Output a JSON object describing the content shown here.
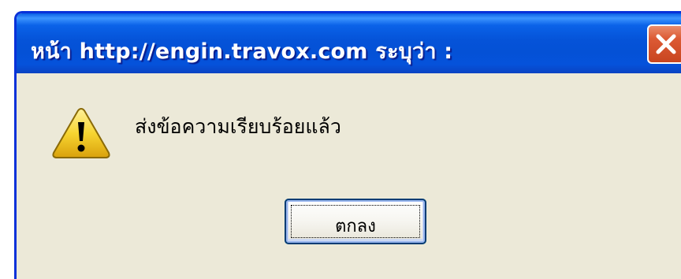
{
  "dialog": {
    "title": "หน้า http://engin.travox.com ระบุว่า :",
    "message": "ส่งข้อความเรียบร้อยแล้ว",
    "ok_label": "ตกลง",
    "icon": "warning-icon",
    "close_icon": "close-icon"
  },
  "colors": {
    "titlebar": "#0553d8",
    "body": "#ece9d8",
    "close_button": "#dc5a34",
    "warning_fill": "#f7d531"
  }
}
